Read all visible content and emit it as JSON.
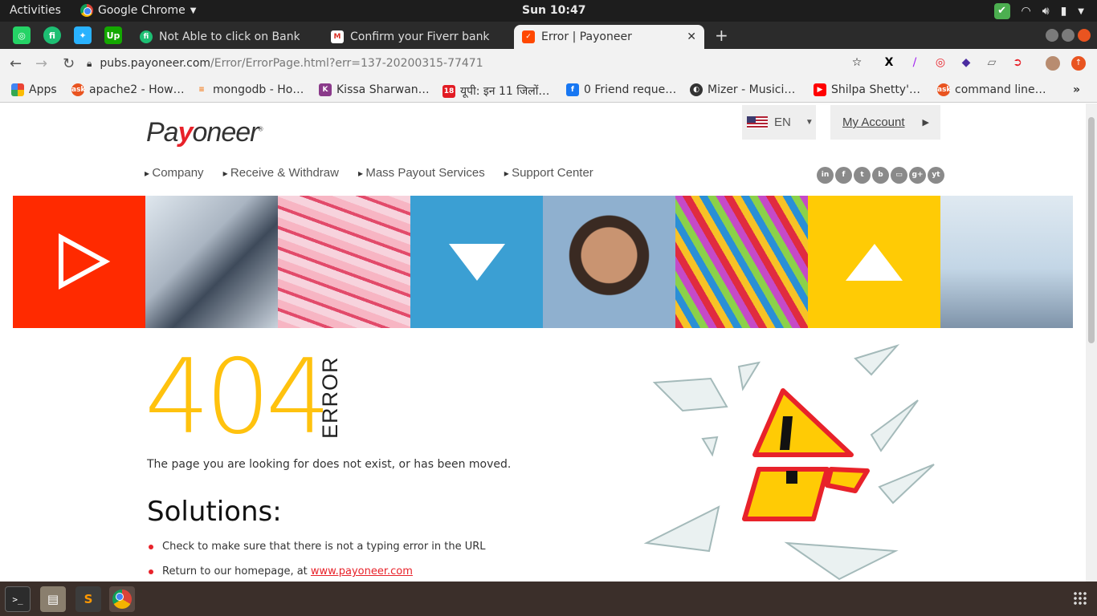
{
  "topbar": {
    "activities": "Activities",
    "app_name": "Google Chrome",
    "clock": "Sun 10:47"
  },
  "tabs": {
    "pinned": [
      {
        "icon": "whatsapp-icon",
        "color": "#25d366",
        "glyph": "◎"
      },
      {
        "icon": "freelancer-icon",
        "color": "#1dbf73",
        "glyph": "fi"
      },
      {
        "icon": "freelancer-bird-icon",
        "color": "#29b2fe",
        "glyph": "✦"
      },
      {
        "icon": "upwork-icon",
        "color": "#14a800",
        "glyph": "Up"
      }
    ],
    "items": [
      {
        "label": "Not Able to click on Bank",
        "icon": "fiverr-icon",
        "color": "#1dbf73"
      },
      {
        "label": "Confirm your Fiverr bank",
        "icon": "gmail-icon",
        "color": "#d93025"
      },
      {
        "label": "Error | Payoneer",
        "icon": "payoneer-icon",
        "color": "#ff4800"
      }
    ]
  },
  "omnibox": {
    "domain": "pubs.payoneer.com",
    "path": "/Error/ErrorPage.html?err=137-20200315-77471"
  },
  "bookmarks": [
    {
      "label": "Apps",
      "icon": "apps-icon",
      "color": "#4285f4"
    },
    {
      "label": "apache2 - How…",
      "icon": "askubuntu-icon",
      "color": "#e95420"
    },
    {
      "label": "mongodb - Ho…",
      "icon": "stackoverflow-icon",
      "color": "#f48024"
    },
    {
      "label": "Kissa Sharwan…",
      "icon": "kissa-icon",
      "color": "#8a3a8a"
    },
    {
      "label": "यूपी: इन 11 जिलों…",
      "icon": "news18-icon",
      "color": "#e21b23"
    },
    {
      "label": "0 Friend reque…",
      "icon": "facebook-icon",
      "color": "#1877f2"
    },
    {
      "label": "Mizer - Musici…",
      "icon": "mizer-icon",
      "color": "#333333"
    },
    {
      "label": "Shilpa Shetty'…",
      "icon": "youtube-icon",
      "color": "#ff0000"
    },
    {
      "label": "command line…",
      "icon": "askubuntu-icon",
      "color": "#e95420"
    }
  ],
  "header": {
    "logo_text_pa": "Pa",
    "logo_text_y": "y",
    "logo_text_rest": "oneer",
    "language": "EN",
    "my_account": "My Account",
    "nav": [
      "Company",
      "Receive & Withdraw",
      "Mass Payout Services",
      "Support Center"
    ],
    "social": [
      "in",
      "f",
      "t",
      "b",
      "g+",
      "yt"
    ]
  },
  "error": {
    "code": "404",
    "label": "ERROR",
    "message": "The page you are looking for does not exist, or has been moved.",
    "solutions_title": "Solutions:",
    "solutions": [
      "Check to make sure that there is not a typing error in the URL",
      "Return to our homepage, at "
    ],
    "homepage_link": "www.payoneer.com"
  },
  "colors": {
    "brand_red": "#ff2a00",
    "brand_yellow": "#ffc20e",
    "brand_blue": "#3b9fd3"
  }
}
